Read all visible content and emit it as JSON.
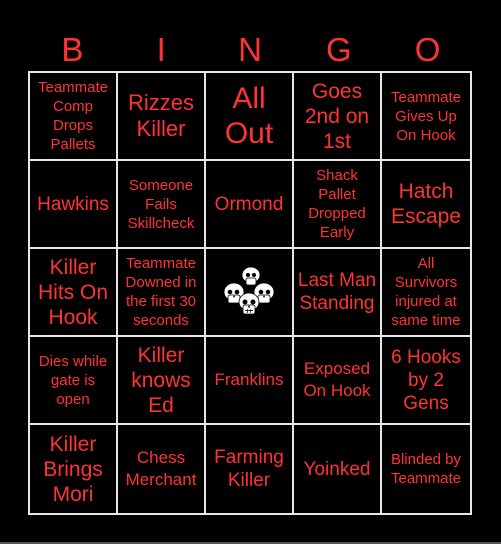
{
  "header": {
    "letters": [
      "B",
      "I",
      "N",
      "G",
      "O"
    ]
  },
  "theme": {
    "text_color": "#ff3333",
    "background": "#000000",
    "grid_line_color": "#e6e6e6"
  },
  "board": {
    "rows": [
      [
        "Teammate Comp Drops Pallets",
        "Rizzes Killer",
        "All Out",
        "Goes 2nd on 1st",
        "Teammate Gives Up On Hook"
      ],
      [
        "Hawkins",
        "Someone Fails Skillcheck",
        "Ormond",
        "Shack Pallet Dropped Early",
        "Hatch Escape"
      ],
      [
        "Killer Hits On Hook",
        "Teammate Downed in the first 30 seconds",
        "FREE",
        "Last Man Standing",
        "All Survivors injured at same time"
      ],
      [
        "Dies while gate is open",
        "Killer knows Ed",
        "Franklins",
        "Exposed On Hook",
        "6 Hooks by 2 Gens"
      ],
      [
        "Killer Brings Mori",
        "Chess Merchant",
        "Farming Killer",
        "Yoinked",
        "Blinded by Teammate"
      ]
    ],
    "free_space": {
      "icon": "skull-pile-icon"
    }
  }
}
